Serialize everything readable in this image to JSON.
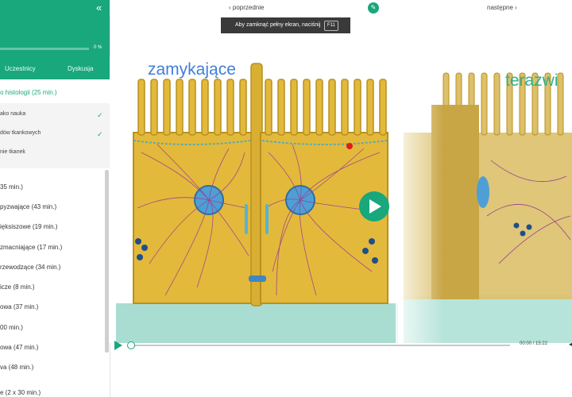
{
  "sidebar": {
    "progress": "0 %",
    "progress_value": 0,
    "tabs": [
      "Uczestnicy",
      "Dyskusja"
    ],
    "chapter": "o histologii (25 min.)",
    "subitems": [
      {
        "label": "ako nauka",
        "done": true
      },
      {
        "label": "dów tkankowych",
        "done": true
      },
      {
        "label": "nie tkanek",
        "done": false
      }
    ],
    "items": [
      "35 min.)",
      "pyzwające (43 min.)",
      "ięksiszowe (19 min.)",
      "zmacniające (17 min.)",
      "rzewodzące (34 min.)",
      "icze (8 min.)",
      "owa (37 min.)",
      "00 min.)",
      "owa (47 min.)",
      "va (48 min.)",
      "e (2 x 30 min.)"
    ]
  },
  "topbar": {
    "prev": "‹ poprzednie",
    "next": "następne ›",
    "fullscreen_text": "Aby zamknąć pełny ekran, naciśnij",
    "fullscreen_key": "F11"
  },
  "video": {
    "label_left": "zamykające",
    "label_right": "terazwi",
    "time": "00:00 / 15:22"
  },
  "colors": {
    "accent": "#19a77c",
    "cell": "#e2b83a",
    "label": "#3f7fd6"
  }
}
